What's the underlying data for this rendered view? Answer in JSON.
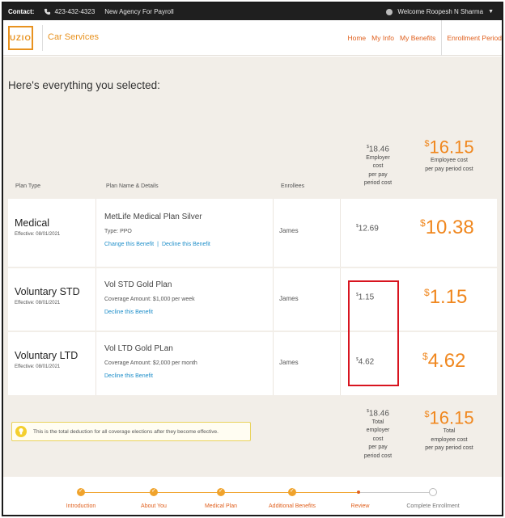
{
  "topbar": {
    "contact_label": "Contact:",
    "phone": "423-432-4323",
    "agency": "New Agency For Payroll",
    "welcome": "Welcome Roopesh N Sharma"
  },
  "header": {
    "logo": "UZIO",
    "company": "Car Services",
    "nav": [
      "Home",
      "My Info",
      "My Benefits",
      "Enrollment Period"
    ]
  },
  "main": {
    "heading": "Here's everything you selected:",
    "columns": {
      "plan_type": "Plan Type",
      "plan_name": "Plan Name & Details",
      "enrollees": "Enrollees"
    },
    "top_summary": {
      "employer_amount": "18.46",
      "employer_label_lines": [
        "Employer",
        "cost",
        "per pay",
        "period cost"
      ],
      "employee_amount": "16.15",
      "employee_label_lines": [
        "Employee cost",
        "per pay period cost"
      ]
    },
    "rows": [
      {
        "plan_type": "Medical",
        "effective": "Effective: 08/01/2021",
        "plan_name": "MetLife Medical Plan Silver",
        "detail": "Type: PPO",
        "link1": "Change this Benefit",
        "separator": "|",
        "link2": "Decline this Benefit",
        "enrollee": "James",
        "employer_cost": "12.69",
        "employee_cost": "10.38"
      },
      {
        "plan_type": "Voluntary STD",
        "effective": "Effective: 08/01/2021",
        "plan_name": "Vol STD Gold Plan",
        "detail": "Coverage Amount: $1,000 per week",
        "link1": "Decline this Benefit",
        "enrollee": "James",
        "employer_cost": "1.15",
        "employee_cost": "1.15"
      },
      {
        "plan_type": "Voluntary LTD",
        "effective": "Effective: 08/01/2021",
        "plan_name": "Vol LTD Gold PLan",
        "detail": "Coverage Amount: $2,000 per month",
        "link1": "Decline this Benefit",
        "enrollee": "James",
        "employer_cost": "4.62",
        "employee_cost": "4.62"
      }
    ],
    "note": "This is the total deduction for all coverage elections after they become effective.",
    "bottom_summary": {
      "employer_amount": "18.46",
      "employer_label_lines": [
        "Total",
        "employer",
        "cost",
        "per pay",
        "period cost"
      ],
      "employee_amount": "16.15",
      "employee_label_lines": [
        "Total",
        "employee cost",
        "per pay period cost"
      ]
    },
    "currency_symbol": "$"
  },
  "progress": {
    "steps": [
      {
        "label": "Introduction",
        "state": "done"
      },
      {
        "label": "About You",
        "state": "done"
      },
      {
        "label": "Medical Plan",
        "state": "done"
      },
      {
        "label": "Additional Benefits",
        "state": "done"
      },
      {
        "label": "Review",
        "state": "current"
      },
      {
        "label": "Complete Enrollment",
        "state": "todo"
      }
    ]
  },
  "colors": {
    "accent": "#f0871e",
    "link": "#1d8ec9",
    "highlight": "#d8141f"
  }
}
